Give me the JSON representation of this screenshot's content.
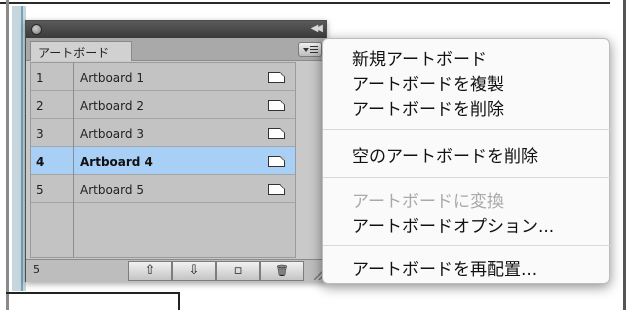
{
  "panel": {
    "tab_label": "アートボード",
    "footer_count": "5",
    "rows": [
      {
        "num": "1",
        "name": "Artboard 1",
        "selected": false
      },
      {
        "num": "2",
        "name": "Artboard 2",
        "selected": false
      },
      {
        "num": "3",
        "name": "Artboard 3",
        "selected": false
      },
      {
        "num": "4",
        "name": "Artboard 4",
        "selected": true
      },
      {
        "num": "5",
        "name": "Artboard 5",
        "selected": false
      }
    ],
    "footer_buttons": {
      "move_up": "⇧",
      "move_down": "⇩",
      "new": "▫",
      "delete": "🗑"
    },
    "selection_color": "#a8cff5"
  },
  "menu": {
    "items": [
      {
        "label": "新規アートボード",
        "enabled": true
      },
      {
        "label": "アートボードを複製",
        "enabled": true
      },
      {
        "label": "アートボードを削除",
        "enabled": true
      },
      {
        "label": "空のアートボードを削除",
        "enabled": true
      },
      {
        "label": "アートボードに変換",
        "enabled": false
      },
      {
        "label": "アートボードオプション...",
        "enabled": true
      },
      {
        "label": "アートボードを再配置...",
        "enabled": true
      }
    ]
  }
}
